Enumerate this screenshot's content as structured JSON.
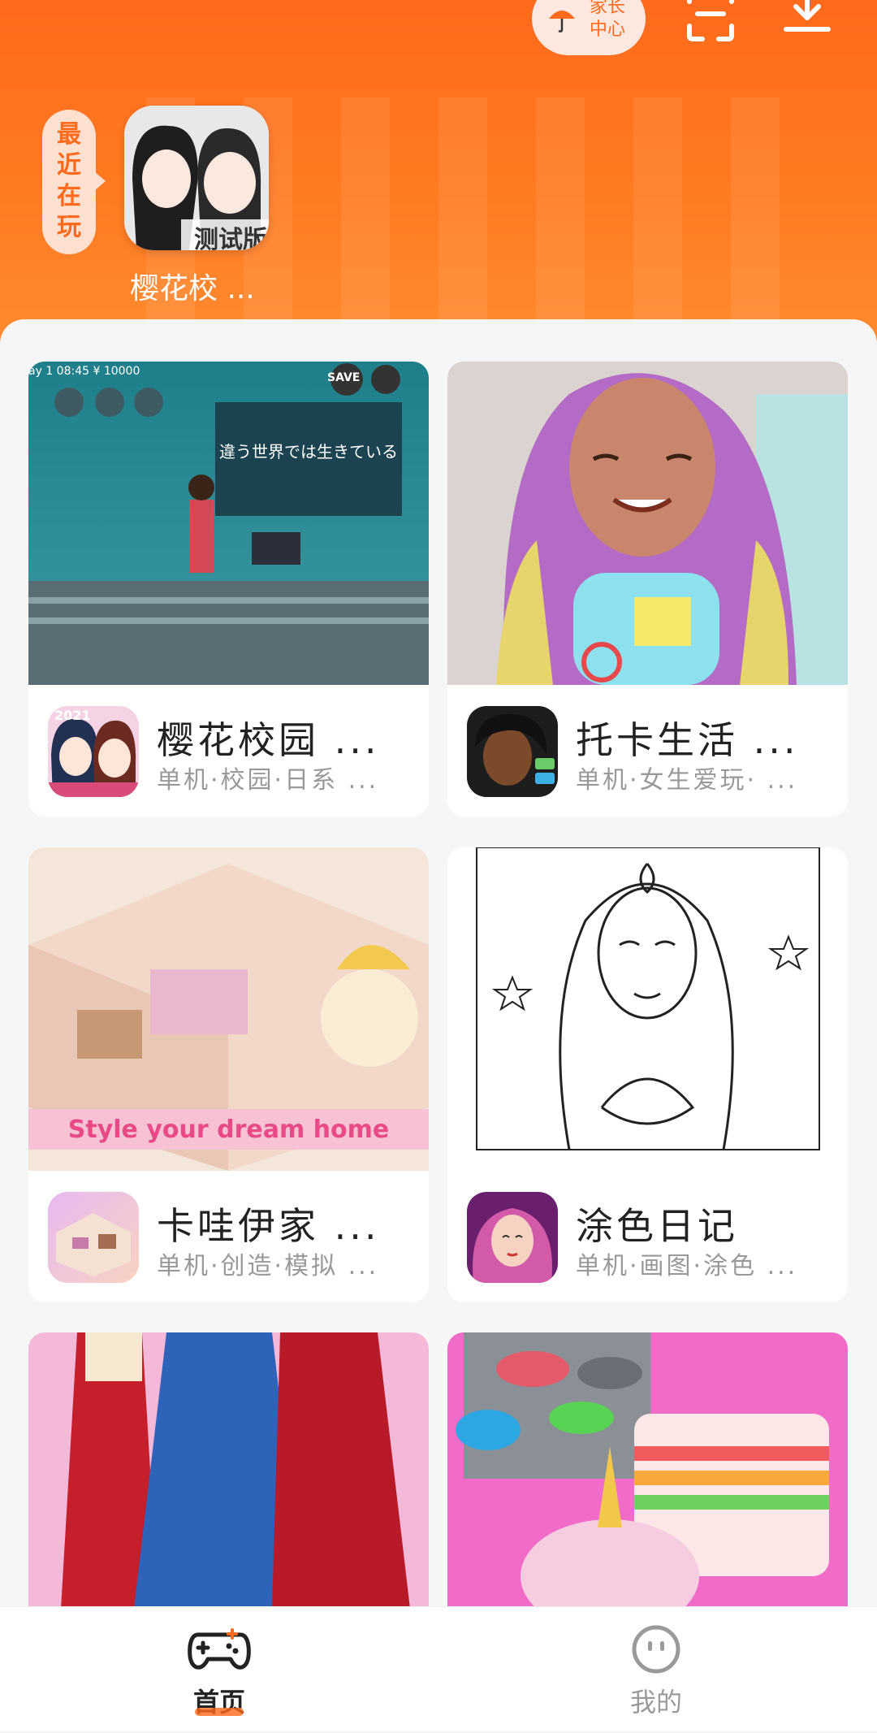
{
  "header": {
    "parent_center_label": "家长中心",
    "recent_label": "最近在玩",
    "recent_game_name": "樱花校 ...",
    "recent_game_badge": "测试版"
  },
  "cards": [
    {
      "title": "樱花校园 ...",
      "tags": "单机·校园·日系 ...",
      "thumb_text": "違う世界では生きている",
      "thumb_hud": "ay 1 08:45 ¥ 10000",
      "save_label": "SAVE",
      "icon_badge": "2021"
    },
    {
      "title": "托卡生活 ...",
      "tags": "单机·女生爱玩· ...",
      "thumb_text": "",
      "thumb_hud": ""
    },
    {
      "title": "卡哇伊家 ...",
      "tags": "单机·创造·模拟 ...",
      "thumb_text": "Style your dream home"
    },
    {
      "title": "涂色日记",
      "tags": "单机·画图·涂色 ..."
    },
    {
      "title": "",
      "tags": ""
    },
    {
      "title": "",
      "tags": ""
    }
  ],
  "tabs": [
    {
      "label": "首页",
      "active": true
    },
    {
      "label": "我的",
      "active": false
    }
  ],
  "colors": {
    "accent": "#ff6a1c",
    "active_tab": "#ff6a1c"
  }
}
